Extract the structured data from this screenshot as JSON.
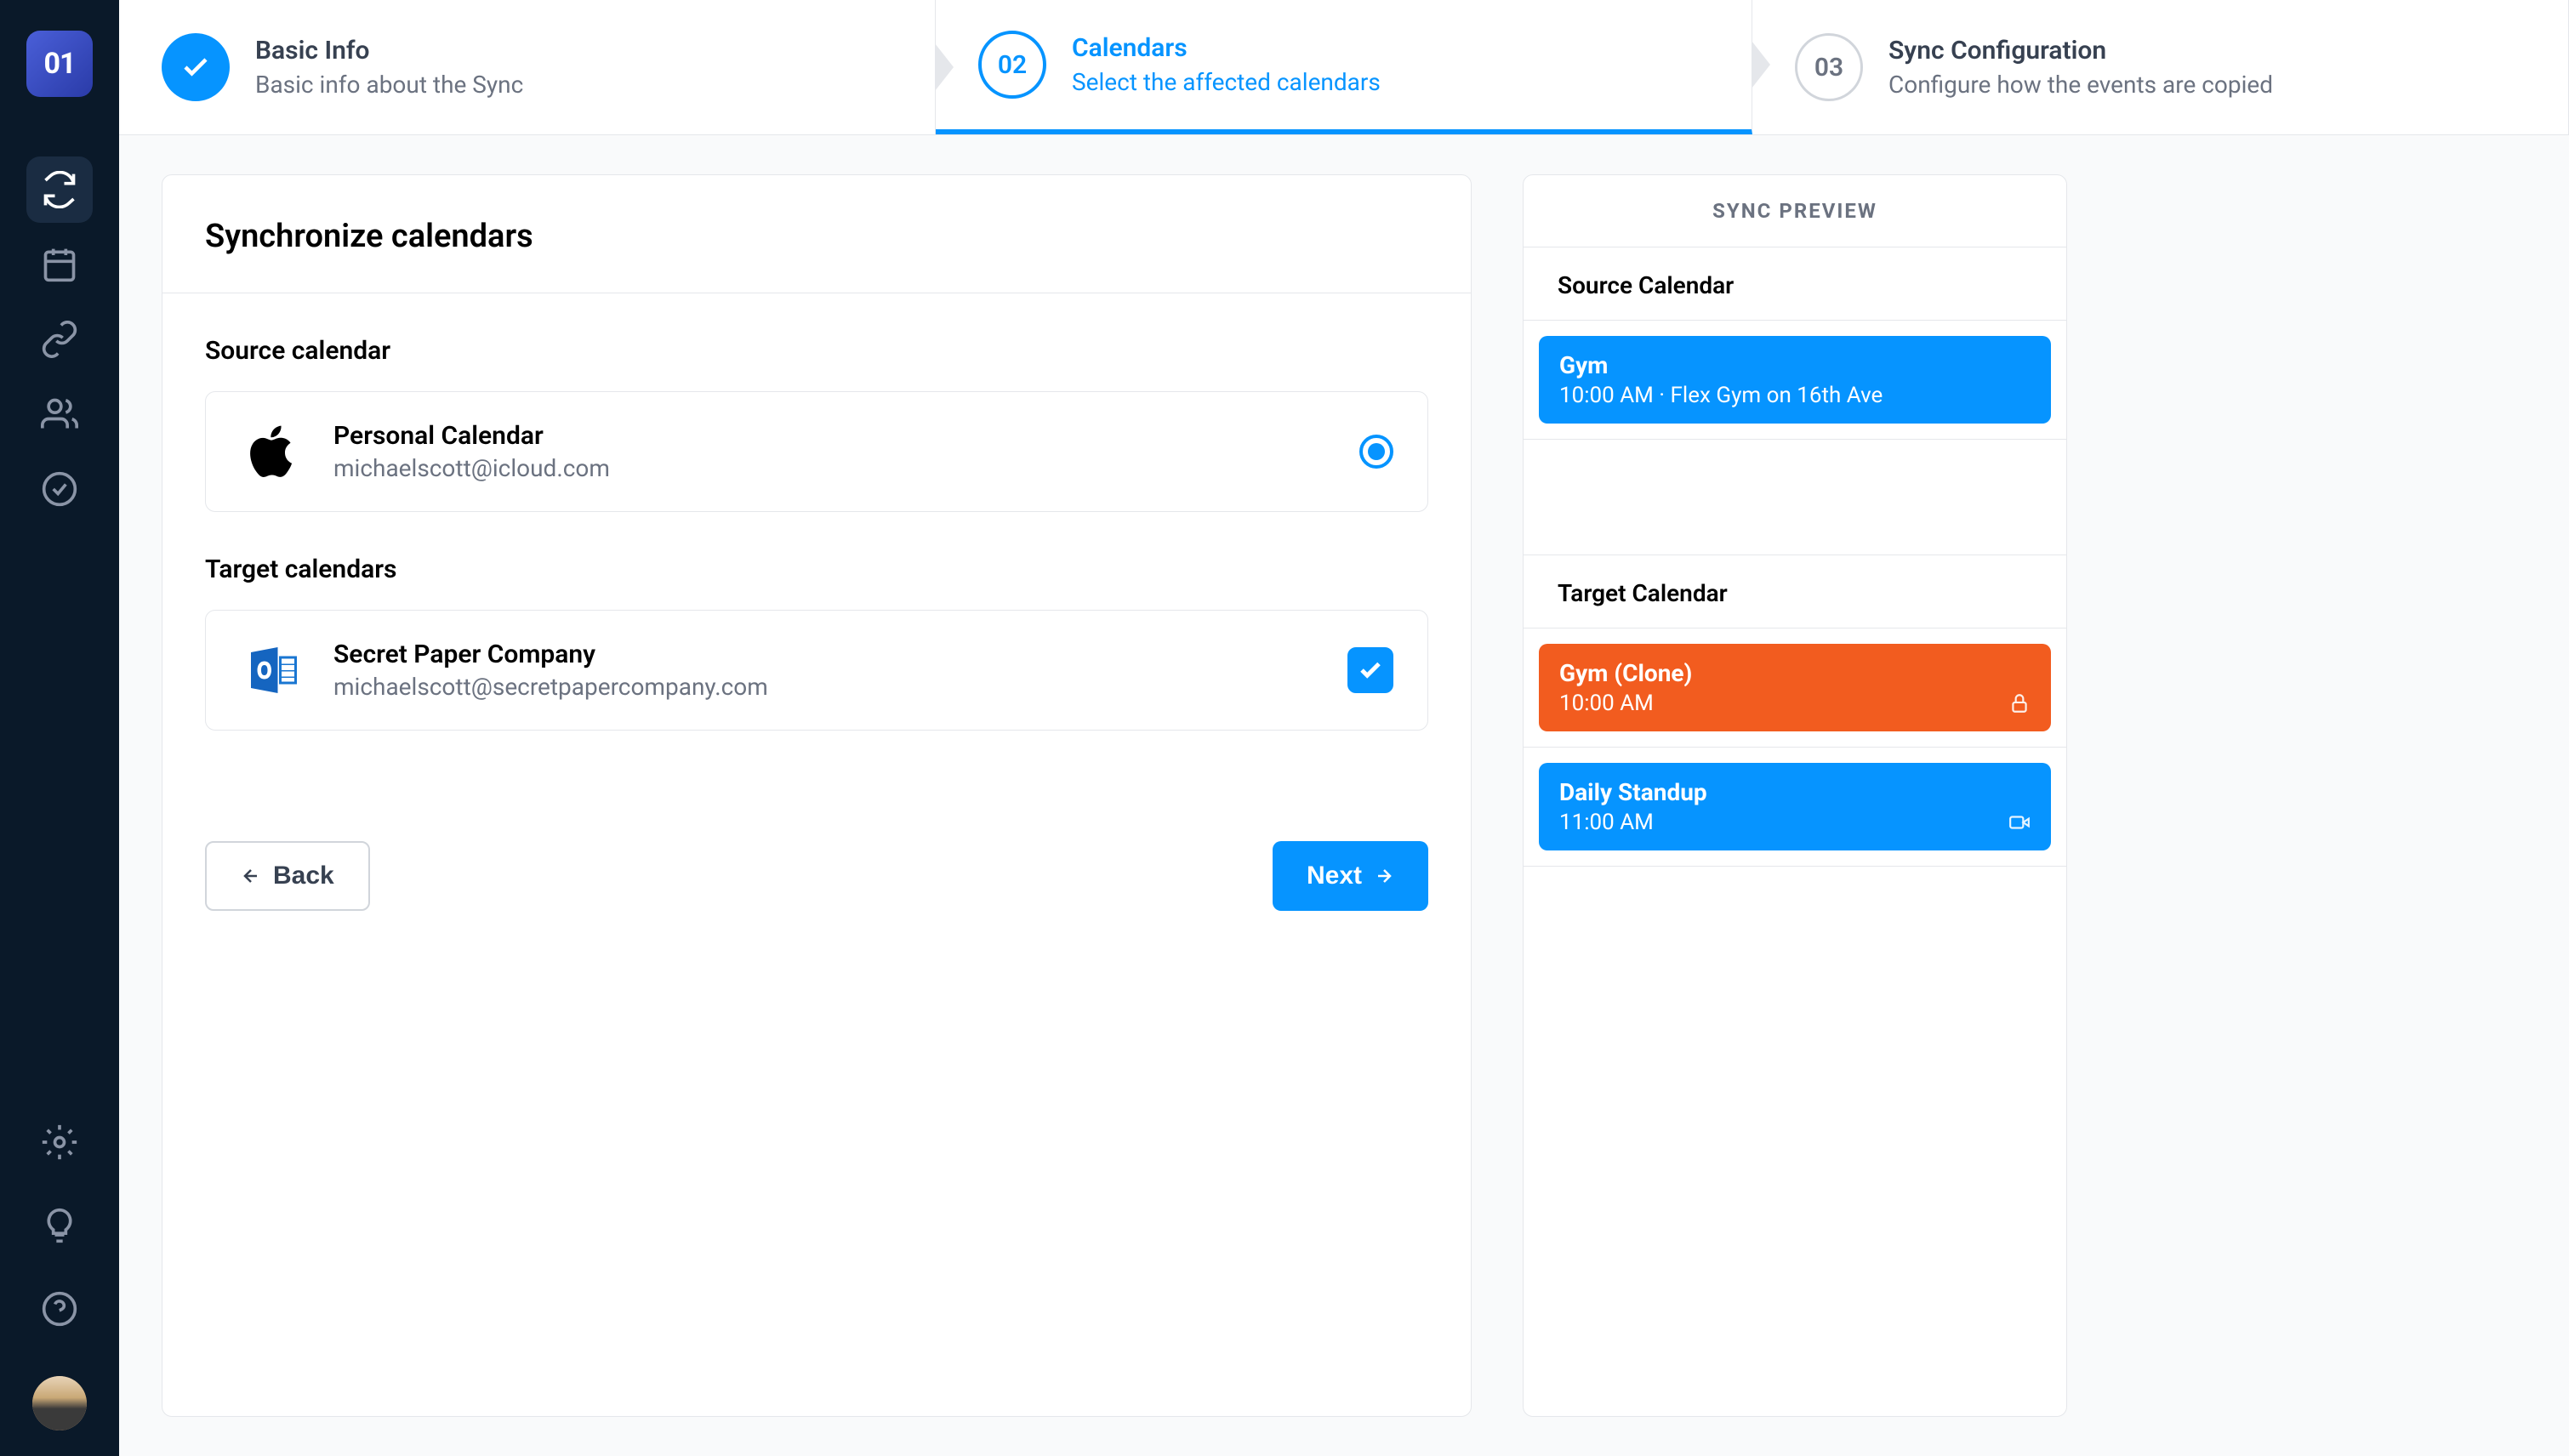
{
  "app": {
    "logo_text": "01"
  },
  "stepper": {
    "step1": {
      "title": "Basic Info",
      "subtitle": "Basic info about the Sync"
    },
    "step2": {
      "num": "02",
      "title": "Calendars",
      "subtitle": "Select the affected calendars"
    },
    "step3": {
      "num": "03",
      "title": "Sync Configuration",
      "subtitle": "Configure how the events are copied"
    }
  },
  "panel": {
    "title": "Synchronize calendars",
    "source_label": "Source calendar",
    "target_label": "Target calendars"
  },
  "source_calendar": {
    "name": "Personal Calendar",
    "email": "michaelscott@icloud.com"
  },
  "target_calendar": {
    "name": "Secret Paper Company",
    "email": "michaelscott@secretpapercompany.com"
  },
  "buttons": {
    "back": "Back",
    "next": "Next"
  },
  "preview": {
    "header": "SYNC PREVIEW",
    "source_label": "Source Calendar",
    "target_label": "Target Calendar",
    "source_events": [
      {
        "title": "Gym",
        "time": "10:00 AM · Flex Gym on 16th Ave",
        "color": "blue"
      }
    ],
    "target_events": [
      {
        "title": "Gym (Clone)",
        "time": "10:00 AM",
        "color": "orange",
        "icon": "lock"
      },
      {
        "title": "Daily Standup",
        "time": "11:00 AM",
        "color": "blue",
        "icon": "video"
      }
    ]
  },
  "colors": {
    "primary": "#0694ff",
    "accent": "#f25c1f"
  }
}
